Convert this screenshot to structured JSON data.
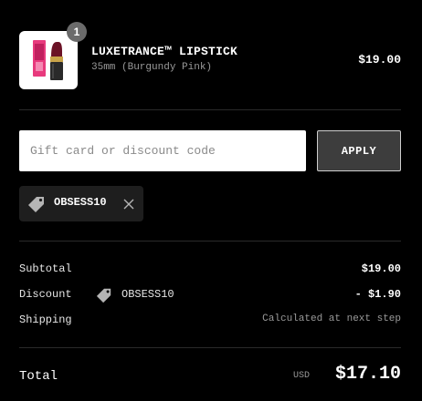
{
  "product": {
    "quantity": "1",
    "name": "LUXETRANCE™ LIPSTICK",
    "variant": "35mm (Burgundy Pink)",
    "price": "$19.00",
    "image_icon": "lipstick-product-image"
  },
  "discount_form": {
    "placeholder": "Gift card or discount code",
    "value": "",
    "apply_label": "APPLY"
  },
  "applied_code": {
    "code": "OBSESS10",
    "icon": "tag-icon",
    "remove_icon": "close-icon"
  },
  "summary": {
    "subtotal_label": "Subtotal",
    "subtotal_value": "$19.00",
    "discount_label": "Discount",
    "discount_code": "OBSESS10",
    "discount_value": "- $1.90",
    "shipping_label": "Shipping",
    "shipping_value": "Calculated at next step"
  },
  "total": {
    "label": "Total",
    "currency": "USD",
    "value": "$17.10"
  },
  "colors": {
    "background": "#000000",
    "text": "#ffffff",
    "muted": "#9a9a9a",
    "chip": "#1e1e1e",
    "button": "#3d3d3d"
  }
}
